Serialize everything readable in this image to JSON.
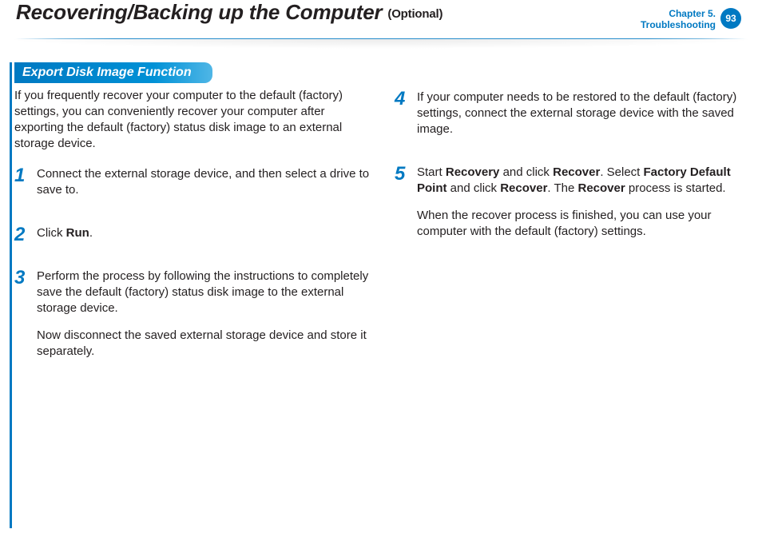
{
  "header": {
    "title_main": "Recovering/Backing up the Computer",
    "title_optional": "(Optional)",
    "chapter_line1": "Chapter 5.",
    "chapter_line2": "Troubleshooting",
    "page_number": "93"
  },
  "section": {
    "title": "Export Disk Image Function",
    "intro": "If you frequently recover your computer to the default (factory) settings, you can conveniently recover your computer after exporting the default (factory) status disk image to an external storage device."
  },
  "steps": {
    "s1": {
      "num": "1",
      "text": "Connect the external storage device, and then select a drive to save to."
    },
    "s2": {
      "num": "2",
      "prefix": "Click ",
      "bold1": "Run",
      "suffix": "."
    },
    "s3": {
      "num": "3",
      "p1": "Perform the process by following the instructions to completely save the default (factory) status disk image to the external storage device.",
      "p2": "Now disconnect the saved external storage device and store it separately."
    },
    "s4": {
      "num": "4",
      "text": "If your computer needs to be restored to the default (factory) settings, connect the external storage device with the saved image."
    },
    "s5": {
      "num": "5",
      "t1": "Start ",
      "b1": "Recovery",
      "t2": " and click ",
      "b2": "Recover",
      "t3": ". Select ",
      "b3": "Factory Default Point",
      "t4": " and click ",
      "b4": "Recover",
      "t5": ". The ",
      "b5": "Recover",
      "t6": " process is started.",
      "p2": "When the recover process is finished, you can use your computer with the default (factory) settings."
    }
  }
}
